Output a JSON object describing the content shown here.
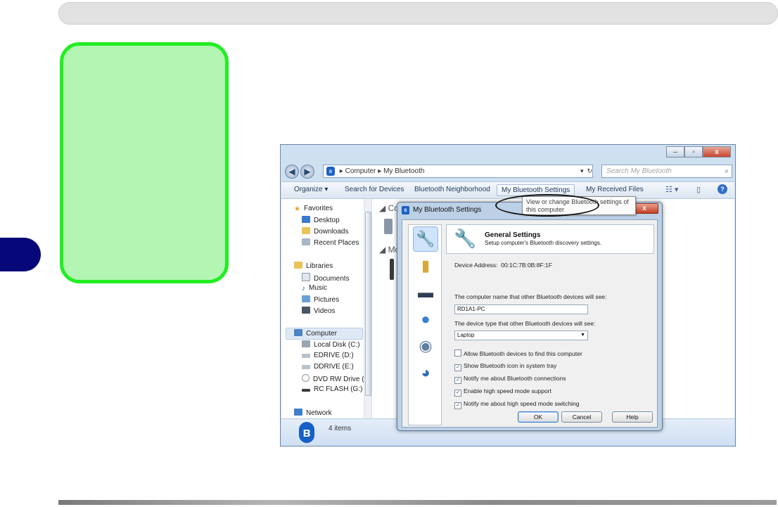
{
  "window": {
    "address": {
      "path": [
        "Computer",
        "My Bluetooth"
      ]
    },
    "search_placeholder": "Search My Bluetooth",
    "toolbar": {
      "organize": "Organize ▾",
      "search_devices": "Search for Devices",
      "neighborhood": "Bluetooth Neighborhood",
      "settings": "My Bluetooth Settings",
      "received": "My Received Files"
    },
    "tooltip": "View or change Bluetooth settings of this computer",
    "nav": {
      "favorites": "Favorites",
      "desktop": "Desktop",
      "downloads": "Downloads",
      "recent": "Recent Places",
      "libraries": "Libraries",
      "documents": "Documents",
      "music": "Music",
      "pictures": "Pictures",
      "videos": "Videos",
      "computer": "Computer",
      "local_disk": "Local Disk (C:)",
      "edrive": "EDRIVE (D:)",
      "ddrive": "DDRIVE (E:)",
      "dvd": "DVD RW Drive (F:",
      "rcflash": "RC FLASH (G:)",
      "network": "Network"
    },
    "content_groups": [
      "Co",
      "Mo"
    ],
    "status": "4 items"
  },
  "dialog": {
    "title": "My Bluetooth Settings",
    "header_title": "General Settings",
    "header_sub": "Setup computer's Bluetooth discovery settings.",
    "device_address_label": "Device Address:",
    "device_address": "00:1C:7B:0B:8F:1F",
    "name_label": "The computer name that other Bluetooth devices will see:",
    "name_value": "RD1A1-PC",
    "type_label": "The device type that other Bluetooth devices will see:",
    "type_value": "Laptop",
    "checkboxes": [
      {
        "label": "Allow Bluetooth devices to find this computer",
        "checked": false
      },
      {
        "label": "Show Bluetooth icon in system tray",
        "checked": true
      },
      {
        "label": "Notify me about Bluetooth connections",
        "checked": true
      },
      {
        "label": "Enable high speed mode support",
        "checked": true
      },
      {
        "label": "Notify me about high speed mode switching",
        "checked": true
      }
    ],
    "buttons": {
      "ok": "OK",
      "cancel": "Cancel",
      "help": "Help"
    }
  }
}
